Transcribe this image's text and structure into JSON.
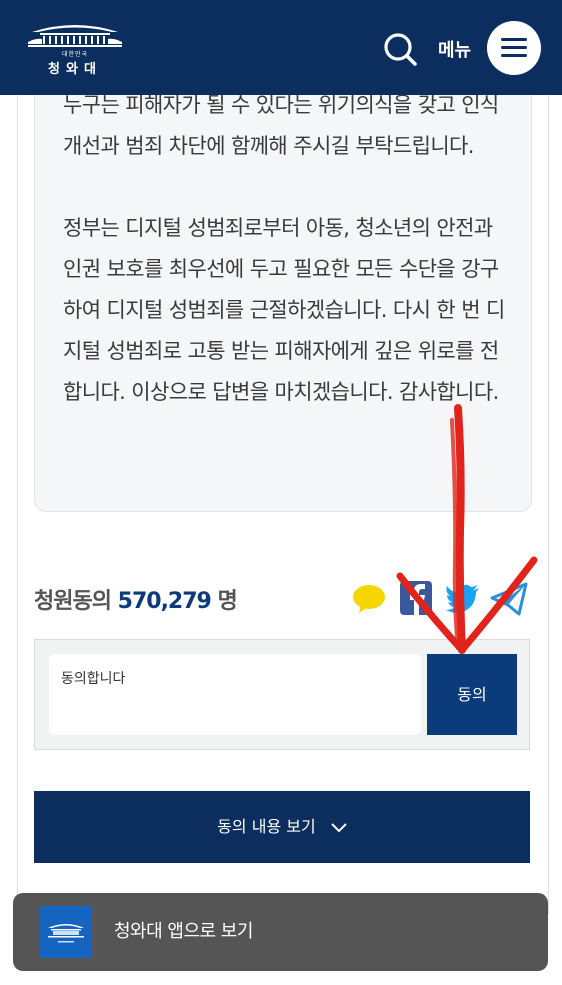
{
  "header": {
    "logo_sub": "대한민국",
    "logo_name": "청와대",
    "menu_label": "메뉴"
  },
  "answer": {
    "paragraph1": "누구는 피해자가 될 수 있다는 위기의식을 갖고 인식개선과 범죄 차단에 함께해 주시길 부탁드립니다.",
    "paragraph2": "정부는 디지털 성범죄로부터 아동, 청소년의 안전과 인권 보호를 최우선에 두고 필요한 모든 수단을 강구하여 디지털 성범죄를 근절하겠습니다. 다시 한 번 디지털 성범죄로 고통 받는 피해자에게 깊은 위로를 전합니다. 이상으로 답변을 마치겠습니다. 감사합니다."
  },
  "petition": {
    "count_label": "청원동의",
    "count_value": "570,279",
    "count_unit": "명"
  },
  "share": {
    "icons": [
      "kakaotalk-icon",
      "facebook-icon",
      "twitter-icon",
      "telegram-icon"
    ],
    "colors": {
      "kakao": "#f7d600",
      "facebook": "#3b5998",
      "twitter": "#1da1f2",
      "telegram": "#2d8fd5"
    }
  },
  "agree": {
    "input_value": "동의합니다",
    "submit_label": "동의"
  },
  "view_button": {
    "label": "동의 내용 보기"
  },
  "app_banner": {
    "label": "청와대 앱으로 보기"
  },
  "colors": {
    "primary": "#0b2e5e",
    "button": "#0b3b7a",
    "annotation_arrow": "#e0241b"
  }
}
